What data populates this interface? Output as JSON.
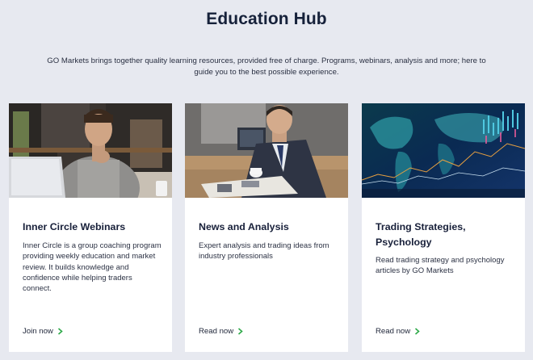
{
  "page": {
    "title": "Education Hub",
    "subtitle": "GO Markets brings together quality learning resources, provided free of charge. Programs, webinars, analysis and more; here to guide you to the best possible experience."
  },
  "colors": {
    "background": "#e7e9f0",
    "card": "#ffffff",
    "title": "#16213a",
    "chevron": "#2faa4a"
  },
  "cards": [
    {
      "title": "Inner Circle Webinars",
      "description": "Inner Circle is a group coaching program providing weekly education and market review. It builds knowledge and confidence while helping traders connect.",
      "link": "Join now",
      "link_icon": "chevron-right-icon"
    },
    {
      "title": "News and Analysis",
      "description": "Expert analysis and trading ideas from industry professionals",
      "link": "Read now",
      "link_icon": "chevron-right-icon"
    },
    {
      "title": "Trading Strategies, Psychology",
      "description": "Read trading strategy and psychology articles by GO Markets",
      "link": "Read now",
      "link_icon": "chevron-right-icon"
    }
  ]
}
